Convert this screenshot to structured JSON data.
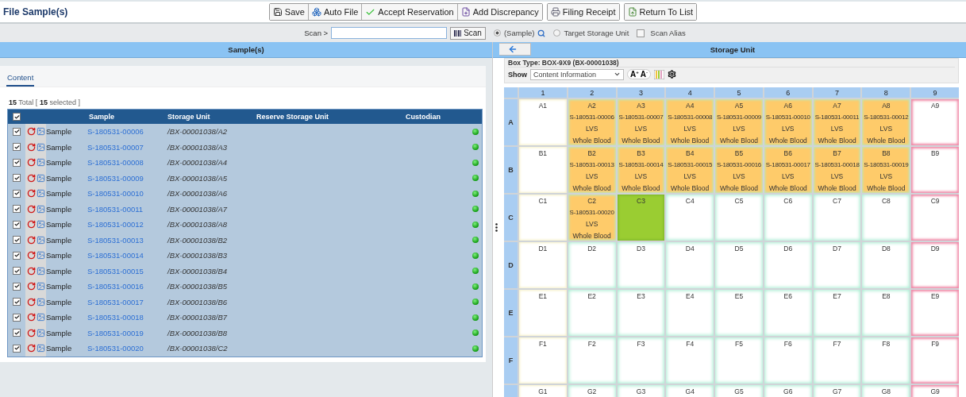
{
  "window": {
    "title": "File Sample(s)"
  },
  "toolbar": [
    {
      "buttons": [
        {
          "label": "Save"
        },
        {
          "label": "Auto File"
        },
        {
          "label": "Accept Reservation"
        },
        {
          "label": "Add Discrepancy"
        }
      ]
    },
    {
      "buttons": [
        {
          "label": "Filing Receipt"
        }
      ]
    },
    {
      "buttons": [
        {
          "label": "Return To List"
        }
      ]
    }
  ],
  "scan_bar": {
    "label": "Scan >",
    "button": "Scan",
    "options": [
      {
        "label": "(Sample)",
        "selected": true
      },
      {
        "label": "Target Storage Unit",
        "selected": false
      }
    ],
    "alias": {
      "label": "Scan Alias",
      "checked": false
    }
  },
  "left_panel": {
    "title": "Sample(s)",
    "tabs": [
      {
        "label": "Content",
        "selected": true
      }
    ],
    "summary": "**15** Total [ **15** selected ]",
    "table": {
      "all_checked": true,
      "columns": [
        "Sample",
        "Storage Unit",
        "Reserve Storage Unit",
        "Custodian"
      ],
      "rows": [
        {
          "checked": true,
          "type": "Sample",
          "sample": "S-180531-00006",
          "storage_unit": "/BX-00001038/A2"
        },
        {
          "checked": true,
          "type": "Sample",
          "sample": "S-180531-00007",
          "storage_unit": "/BX-00001038/A3"
        },
        {
          "checked": true,
          "type": "Sample",
          "sample": "S-180531-00008",
          "storage_unit": "/BX-00001038/A4"
        },
        {
          "checked": true,
          "type": "Sample",
          "sample": "S-180531-00009",
          "storage_unit": "/BX-00001038/A5"
        },
        {
          "checked": true,
          "type": "Sample",
          "sample": "S-180531-00010",
          "storage_unit": "/BX-00001038/A6"
        },
        {
          "checked": true,
          "type": "Sample",
          "sample": "S-180531-00011",
          "storage_unit": "/BX-00001038/A7"
        },
        {
          "checked": true,
          "type": "Sample",
          "sample": "S-180531-00012",
          "storage_unit": "/BX-00001038/A8"
        },
        {
          "checked": true,
          "type": "Sample",
          "sample": "S-180531-00013",
          "storage_unit": "/BX-00001038/B2"
        },
        {
          "checked": true,
          "type": "Sample",
          "sample": "S-180531-00014",
          "storage_unit": "/BX-00001038/B3"
        },
        {
          "checked": true,
          "type": "Sample",
          "sample": "S-180531-00015",
          "storage_unit": "/BX-00001038/B4"
        },
        {
          "checked": true,
          "type": "Sample",
          "sample": "S-180531-00016",
          "storage_unit": "/BX-00001038/B5"
        },
        {
          "checked": true,
          "type": "Sample",
          "sample": "S-180531-00017",
          "storage_unit": "/BX-00001038/B6"
        },
        {
          "checked": true,
          "type": "Sample",
          "sample": "S-180531-00018",
          "storage_unit": "/BX-00001038/B7"
        },
        {
          "checked": true,
          "type": "Sample",
          "sample": "S-180531-00019",
          "storage_unit": "/BX-00001038/B8"
        },
        {
          "checked": true,
          "type": "Sample",
          "sample": "S-180531-00020",
          "storage_unit": "/BX-00001038/C2"
        }
      ]
    }
  },
  "right_panel": {
    "title": "Storage Unit",
    "box_type": "Box Type: BOX-9X9 (BX-00001038)",
    "show_label": "Show",
    "show_value": "Content Information",
    "font_buttons": [
      "A$^{+}$",
      "A$^{-}$"
    ],
    "grid": {
      "columns": [
        "1",
        "2",
        "3",
        "4",
        "5",
        "6",
        "7",
        "8",
        "9"
      ],
      "rows": [
        {
          "label": "A",
          "cells": [
            {
              "label": "A1",
              "kind": "edge"
            },
            {
              "label": "A2",
              "kind": "filled",
              "sample": "S-180531-00006",
              "type": "LVS",
              "material": "Whole Blood"
            },
            {
              "label": "A3",
              "kind": "filled",
              "sample": "S-180531-00007",
              "type": "LVS",
              "material": "Whole Blood"
            },
            {
              "label": "A4",
              "kind": "filled",
              "sample": "S-180531-00008",
              "type": "LVS",
              "material": "Whole Blood"
            },
            {
              "label": "A5",
              "kind": "filled",
              "sample": "S-180531-00009",
              "type": "LVS",
              "material": "Whole Blood"
            },
            {
              "label": "A6",
              "kind": "filled",
              "sample": "S-180531-00010",
              "type": "LVS",
              "material": "Whole Blood"
            },
            {
              "label": "A7",
              "kind": "filled",
              "sample": "S-180531-00011",
              "type": "LVS",
              "material": "Whole Blood"
            },
            {
              "label": "A8",
              "kind": "filled",
              "sample": "S-180531-00012",
              "type": "LVS",
              "material": "Whole Blood"
            },
            {
              "label": "A9",
              "kind": "blocked"
            }
          ]
        },
        {
          "label": "B",
          "cells": [
            {
              "label": "B1",
              "kind": "edge"
            },
            {
              "label": "B2",
              "kind": "filled",
              "sample": "S-180531-00013",
              "type": "LVS",
              "material": "Whole Blood"
            },
            {
              "label": "B3",
              "kind": "filled",
              "sample": "S-180531-00014",
              "type": "LVS",
              "material": "Whole Blood"
            },
            {
              "label": "B4",
              "kind": "filled",
              "sample": "S-180531-00015",
              "type": "LVS",
              "material": "Whole Blood"
            },
            {
              "label": "B5",
              "kind": "filled",
              "sample": "S-180531-00016",
              "type": "LVS",
              "material": "Whole Blood"
            },
            {
              "label": "B6",
              "kind": "filled",
              "sample": "S-180531-00017",
              "type": "LVS",
              "material": "Whole Blood"
            },
            {
              "label": "B7",
              "kind": "filled",
              "sample": "S-180531-00018",
              "type": "LVS",
              "material": "Whole Blood"
            },
            {
              "label": "B8",
              "kind": "filled",
              "sample": "S-180531-00019",
              "type": "LVS",
              "material": "Whole Blood"
            },
            {
              "label": "B9",
              "kind": "blocked"
            }
          ]
        },
        {
          "label": "C",
          "cells": [
            {
              "label": "C1",
              "kind": "edge"
            },
            {
              "label": "C2",
              "kind": "filled",
              "sample": "S-180531-00020",
              "type": "LVS",
              "material": "Whole Blood"
            },
            {
              "label": "C3",
              "kind": "target"
            },
            {
              "label": "C4",
              "kind": "open"
            },
            {
              "label": "C5",
              "kind": "open"
            },
            {
              "label": "C6",
              "kind": "open"
            },
            {
              "label": "C7",
              "kind": "open"
            },
            {
              "label": "C8",
              "kind": "open"
            },
            {
              "label": "C9",
              "kind": "blocked"
            }
          ]
        },
        {
          "label": "D",
          "cells": [
            {
              "label": "D1",
              "kind": "edge"
            },
            {
              "label": "D2",
              "kind": "open"
            },
            {
              "label": "D3",
              "kind": "open"
            },
            {
              "label": "D4",
              "kind": "open"
            },
            {
              "label": "D5",
              "kind": "open"
            },
            {
              "label": "D6",
              "kind": "open"
            },
            {
              "label": "D7",
              "kind": "open"
            },
            {
              "label": "D8",
              "kind": "open"
            },
            {
              "label": "D9",
              "kind": "blocked"
            }
          ]
        },
        {
          "label": "E",
          "cells": [
            {
              "label": "E1",
              "kind": "edge"
            },
            {
              "label": "E2",
              "kind": "open"
            },
            {
              "label": "E3",
              "kind": "open"
            },
            {
              "label": "E4",
              "kind": "open"
            },
            {
              "label": "E5",
              "kind": "open"
            },
            {
              "label": "E6",
              "kind": "open"
            },
            {
              "label": "E7",
              "kind": "open"
            },
            {
              "label": "E8",
              "kind": "open"
            },
            {
              "label": "E9",
              "kind": "blocked"
            }
          ]
        },
        {
          "label": "F",
          "cells": [
            {
              "label": "F1",
              "kind": "edge"
            },
            {
              "label": "F2",
              "kind": "open"
            },
            {
              "label": "F3",
              "kind": "open"
            },
            {
              "label": "F4",
              "kind": "open"
            },
            {
              "label": "F5",
              "kind": "open"
            },
            {
              "label": "F6",
              "kind": "open"
            },
            {
              "label": "F7",
              "kind": "open"
            },
            {
              "label": "F8",
              "kind": "open"
            },
            {
              "label": "F9",
              "kind": "blocked"
            }
          ]
        },
        {
          "cells": [
            {
              "label": "G1",
              "kind": "edge"
            },
            {
              "label": "G2",
              "kind": "open"
            },
            {
              "label": "G3",
              "kind": "open"
            },
            {
              "label": "G4",
              "kind": "open"
            },
            {
              "label": "G5",
              "kind": "open"
            },
            {
              "label": "G6",
              "kind": "open"
            },
            {
              "label": "G7",
              "kind": "open"
            },
            {
              "label": "G8",
              "kind": "open"
            },
            {
              "label": "G9",
              "kind": "blocked"
            }
          ]
        }
      ]
    }
  }
}
